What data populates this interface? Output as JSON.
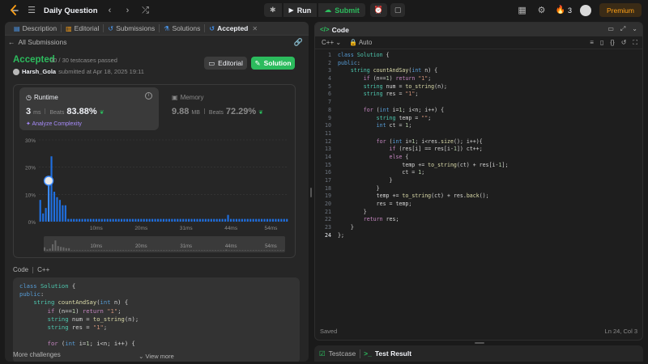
{
  "topbar": {
    "problem_list": "Daily Question",
    "run": "Run",
    "submit": "Submit",
    "streak": "3",
    "premium": "Premium"
  },
  "left_tabs": [
    {
      "label": "Description"
    },
    {
      "label": "Editorial"
    },
    {
      "label": "Submissions"
    },
    {
      "label": "Solutions"
    },
    {
      "label": "Accepted"
    }
  ],
  "submission": {
    "back_label": "All Submissions",
    "status": "Accepted",
    "testcases": "30 / 30 testcases passed",
    "user": "Harsh_Gola",
    "submitted_at": "submitted at Apr 18, 2025 19:11",
    "editorial_btn": "Editorial",
    "solution_btn": "Solution",
    "runtime_label": "Runtime",
    "runtime_value": "3",
    "runtime_unit": "ms",
    "runtime_beats_label": "Beats",
    "runtime_beats": "83.88%",
    "analyze": "Analyze Complexity",
    "memory_label": "Memory",
    "memory_value": "9.88",
    "memory_unit": "MB",
    "memory_beats_label": "Beats",
    "memory_beats": "72.29%",
    "code_label": "Code",
    "code_lang": "C++",
    "view_more": "View more",
    "more_challenges": "More challenges"
  },
  "chart_data": {
    "type": "bar",
    "y_ticks": [
      "30%",
      "20%",
      "10%",
      "0%"
    ],
    "ylim": [
      0,
      30
    ],
    "x_ticks": [
      "10ms",
      "20ms",
      "31ms",
      "44ms",
      "54ms"
    ],
    "selected_bar": 3,
    "values": [
      8,
      3,
      5,
      15,
      24,
      11,
      9,
      8,
      6,
      6,
      1,
      1,
      1,
      1,
      1,
      1,
      1,
      1,
      1,
      1,
      1,
      1,
      1,
      1,
      1,
      1,
      1,
      1,
      1,
      1,
      1,
      1,
      1,
      1,
      1,
      1,
      1,
      1,
      1,
      1,
      1,
      1,
      1,
      1,
      1,
      1,
      1,
      1,
      1,
      1,
      1,
      1,
      1,
      1,
      1,
      1,
      1,
      1,
      1,
      1,
      1,
      1,
      1,
      1,
      1,
      1,
      1,
      2.5,
      1,
      1,
      1,
      1,
      1,
      1,
      1,
      1,
      1,
      1,
      1,
      1,
      1,
      1,
      1,
      1,
      1,
      1,
      1,
      1,
      1
    ]
  },
  "preview_code": [
    "class Solution {",
    "public:",
    "    string countAndSay(int n) {",
    "        if (n==1) return \"1\";",
    "        string num = to_string(n);",
    "        string res = \"1\";",
    "",
    "        for (int i=1; i<n; i++) {"
  ],
  "editor": {
    "tab": "Code",
    "language": "C++",
    "auto": "Auto",
    "status": "Saved",
    "cursor": "Ln 24, Col 3",
    "lines": [
      "class Solution {",
      "public:",
      "    string countAndSay(int n) {",
      "        if (n==1) return \"1\";",
      "        string num = to_string(n);",
      "        string res = \"1\";",
      "",
      "        for (int i=1; i<n; i++) {",
      "            string temp = \"\";",
      "            int ct = 1;",
      "",
      "            for (int i=1; i<res.size(); i++){",
      "                if (res[i] == res[i-1]) ct++;",
      "                else {",
      "                    temp += to_string(ct) + res[i-1];",
      "                    ct = 1;",
      "                }",
      "            }",
      "            temp += to_string(ct) + res.back();",
      "            res = temp;",
      "        }",
      "        return res;",
      "    }",
      "};"
    ]
  },
  "bottom_tabs": {
    "testcase": "Testcase",
    "result": "Test Result"
  }
}
